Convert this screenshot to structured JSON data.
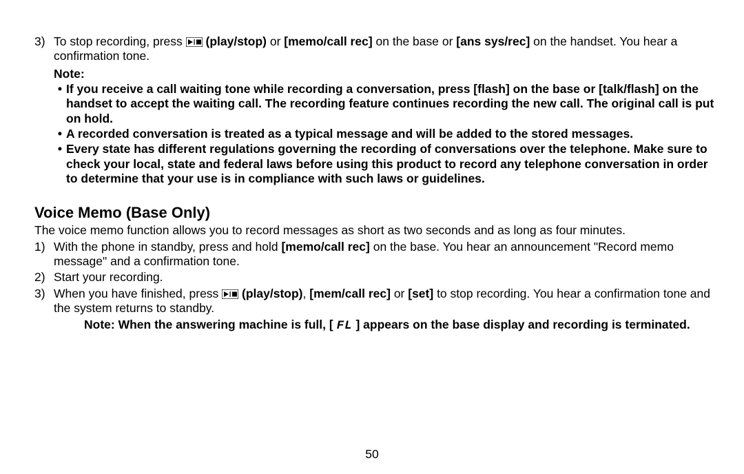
{
  "top_list": {
    "item3": {
      "num": "3)",
      "text_pre": "To stop recording, press ",
      "play_stop": " (play/stop)",
      "text_mid1": " or ",
      "memo": "[memo/call rec]",
      "text_mid2": " on the base or ",
      "ans": "[ans sys/rec]",
      "text_post": " on the handset. You hear a confirmation tone."
    }
  },
  "note": {
    "label": "Note:",
    "bullets": [
      "If you receive a call waiting tone while recording a conversation, press [flash] on the base or [talk/flash] on the handset to accept the waiting call. The recording feature continues recording the new call. The original call is put on hold.",
      "A recorded conversation is treated as a typical message and will be added to the stored messages.",
      "Every state has different regulations governing the recording of conversations over the telephone. Make sure to check your local, state and federal laws before using this product to record any telephone conversation in order to determine that your use is in compliance with such laws or guidelines."
    ]
  },
  "section": {
    "heading": "Voice Memo (Base Only)",
    "intro": "The voice memo function allows you to record messages as short as two seconds and as long as four minutes.",
    "item1": {
      "num": "1)",
      "pre": "With the phone in standby, press and hold ",
      "memo": "[memo/call rec]",
      "post": " on the base. You hear an announcement \"Record memo message\" and a confirmation tone."
    },
    "item2": {
      "num": "2)",
      "text": "Start your recording."
    },
    "item3": {
      "num": "3)",
      "pre": "When you have finished, press ",
      "play_stop": " (play/stop)",
      "mid1": ", ",
      "mem": "[mem/call rec]",
      "mid2": " or ",
      "set": "[set]",
      "post": " to stop recording. You hear a confirmation tone and the system returns to standby."
    },
    "subnote": {
      "pre": "Note: When the answering machine is full, [ ",
      "fl": "FL",
      "post": " ] appears on the base display and recording is terminated."
    }
  },
  "page_number": "50"
}
